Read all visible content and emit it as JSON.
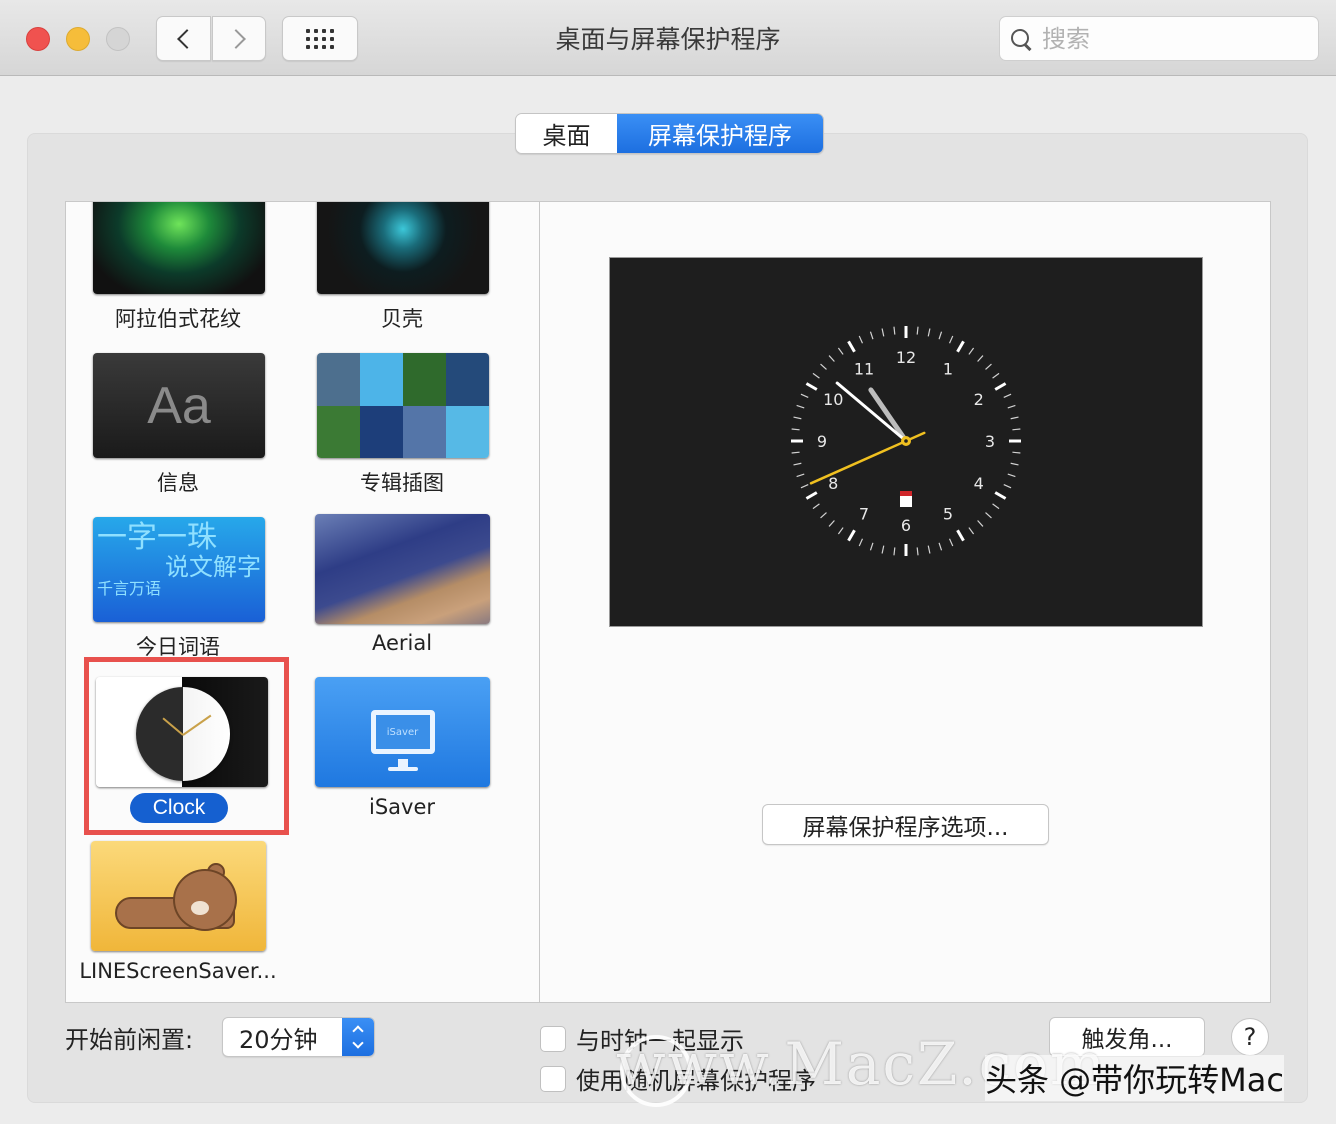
{
  "window": {
    "title": "桌面与屏幕保护程序",
    "search_placeholder": "搜索"
  },
  "tabs": [
    {
      "label": "桌面",
      "active": false
    },
    {
      "label": "屏幕保护程序",
      "active": true
    }
  ],
  "screensavers": [
    {
      "label": "阿拉伯式花纹",
      "thumb": "arabesque"
    },
    {
      "label": "贝壳",
      "thumb": "shell"
    },
    {
      "label": "信息",
      "thumb": "message",
      "thumb_text": "Aa"
    },
    {
      "label": "专辑插图",
      "thumb": "album-artwork"
    },
    {
      "label": "今日词语",
      "thumb": "word-of-day",
      "thumb_lines": [
        "一字一珠",
        "说文解字",
        "千言万语"
      ]
    },
    {
      "label": "Aerial",
      "thumb": "aerial"
    },
    {
      "label": "Clock",
      "thumb": "clock",
      "selected": true
    },
    {
      "label": "iSaver",
      "thumb": "isaver",
      "thumb_text": "iSaver"
    },
    {
      "label": "LINEScreenSaver...",
      "thumb": "line-bear"
    }
  ],
  "preview": {
    "clock": {
      "numbers": [
        "12",
        "1",
        "2",
        "3",
        "4",
        "5",
        "6",
        "7",
        "8",
        "9",
        "10",
        "11"
      ],
      "time": {
        "hour": 10,
        "minute": 51,
        "second": 41
      },
      "colors": {
        "face": "#1e1e1e",
        "tick": "#ffffff",
        "hour_hand": "#bdbdbd",
        "minute_hand": "#ffffff",
        "second_hand": "#f0c020"
      }
    }
  },
  "options_button": "屏幕保护程序选项...",
  "idle": {
    "label": "开始前闲置:",
    "value": "20分钟"
  },
  "checkboxes": [
    {
      "label": "与时钟一起显示",
      "checked": false
    },
    {
      "label": "使用随机屏幕保护程序",
      "checked": false
    }
  ],
  "hot_corners_button": "触发角...",
  "help_button": "?",
  "watermark": {
    "site": "www.MacZ.com",
    "credit": "头条 @带你玩转Mac"
  },
  "colors": {
    "accent": "#1d6fe0",
    "selection_highlight": "#e8514d",
    "close": "#f0524f",
    "minimize": "#f6bd3a"
  }
}
